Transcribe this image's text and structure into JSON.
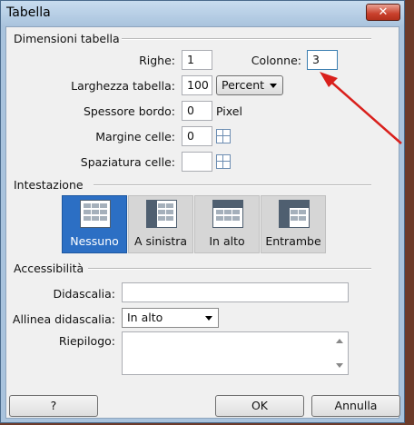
{
  "window": {
    "title": "Tabella",
    "close_glyph": "✕"
  },
  "dimensions": {
    "section_label": "Dimensioni tabella",
    "rows_label": "Righe:",
    "rows_value": "1",
    "cols_label": "Colonne:",
    "cols_value": "3",
    "width_label": "Larghezza tabella:",
    "width_value": "100",
    "width_unit": "Percent",
    "border_label": "Spessore bordo:",
    "border_value": "0",
    "border_unit": "Pixel",
    "padding_label": "Margine celle:",
    "padding_value": "0",
    "spacing_label": "Spaziatura celle:",
    "spacing_value": ""
  },
  "header": {
    "section_label": "Intestazione",
    "options": [
      {
        "label": "Nessuno",
        "selected": true
      },
      {
        "label": "A sinistra",
        "selected": false
      },
      {
        "label": "In alto",
        "selected": false
      },
      {
        "label": "Entrambe",
        "selected": false
      }
    ]
  },
  "accessibility": {
    "section_label": "Accessibilità",
    "caption_label": "Didascalia:",
    "caption_value": "",
    "align_label": "Allinea didascalia:",
    "align_value": "In alto",
    "summary_label": "Riepilogo:",
    "summary_value": ""
  },
  "buttons": {
    "help": "?",
    "ok": "OK",
    "cancel": "Annulla"
  },
  "colors": {
    "accent_selected": "#2c6fc4",
    "annotation_arrow": "#d9201c",
    "close_button": "#c9402c"
  }
}
